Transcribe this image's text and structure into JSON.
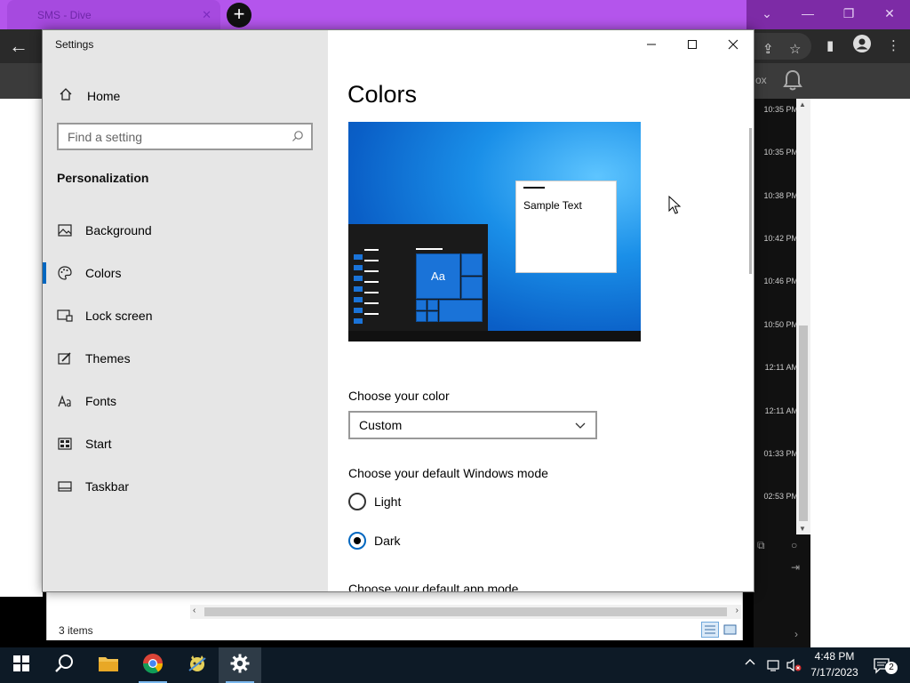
{
  "browser": {
    "tab_title": "SMS - Dive",
    "tab_close": "✕",
    "new_tab": "+",
    "window_controls": [
      "⌄",
      "—",
      "❐",
      "✕"
    ],
    "web_partial_label": "ox",
    "timestamps": [
      "10:35 PM",
      "10:35 PM",
      "10:38 PM",
      "10:42 PM",
      "10:46 PM",
      "10:50 PM",
      "12:11 AM",
      "12:11 AM",
      "01:33 PM",
      "02:53 PM"
    ]
  },
  "settings": {
    "window_title": "Settings",
    "home_label": "Home",
    "search_placeholder": "Find a setting",
    "section_label": "Personalization",
    "nav_items": [
      {
        "label": "Background",
        "icon": "picture-icon"
      },
      {
        "label": "Colors",
        "icon": "palette-icon"
      },
      {
        "label": "Lock screen",
        "icon": "lock-screen-icon"
      },
      {
        "label": "Themes",
        "icon": "themes-icon"
      },
      {
        "label": "Fonts",
        "icon": "fonts-icon"
      },
      {
        "label": "Start",
        "icon": "start-icon"
      },
      {
        "label": "Taskbar",
        "icon": "taskbar-icon"
      }
    ],
    "active_nav": "Colors",
    "page_title": "Colors",
    "preview_sample_text": "Sample Text",
    "preview_tile_text": "Aa",
    "choose_color_label": "Choose your color",
    "choose_color_value": "Custom",
    "windows_mode_label": "Choose your default Windows mode",
    "windows_mode_options": [
      "Light",
      "Dark"
    ],
    "windows_mode_selected": "Dark",
    "app_mode_label": "Choose your default app mode",
    "accent_color": "#0067c0"
  },
  "explorer": {
    "items_count": "3 items"
  },
  "taskbar": {
    "time": "4:48 PM",
    "date": "7/17/2023",
    "notification_count": "2",
    "apps": [
      "windows-start-icon",
      "search-icon",
      "file-explorer-icon",
      "chrome-icon",
      "app-icon",
      "settings-gear-icon"
    ]
  }
}
